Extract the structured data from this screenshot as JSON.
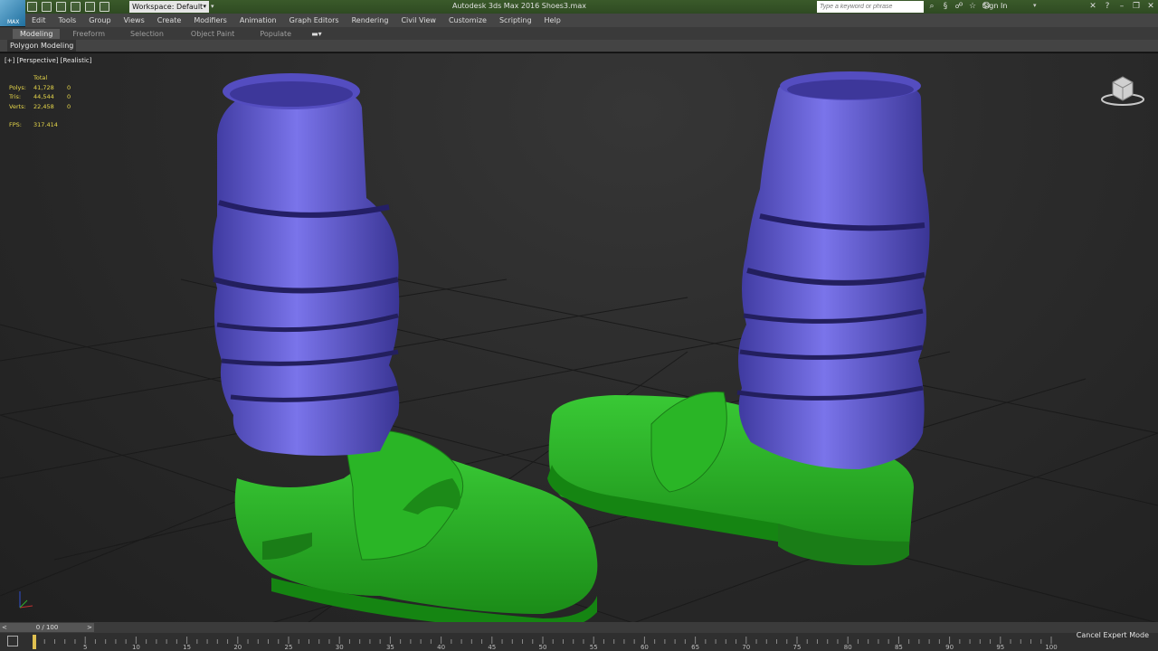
{
  "titlebar": {
    "app_title": "Autodesk 3ds Max 2016      Shoes3.max",
    "workspace": "Workspace: Default",
    "search_placeholder": "Type a keyword or phrase",
    "sign_in": "Sign In",
    "logo": "MAX"
  },
  "menu": [
    "Edit",
    "Tools",
    "Group",
    "Views",
    "Create",
    "Modifiers",
    "Animation",
    "Graph Editors",
    "Rendering",
    "Civil View",
    "Customize",
    "Scripting",
    "Help"
  ],
  "ribbon": {
    "tabs": [
      "Modeling",
      "Freeform",
      "Selection",
      "Object Paint",
      "Populate"
    ],
    "active_tab": "Modeling",
    "panel_label": "Polygon Modeling"
  },
  "viewport": {
    "label": "[+] [Perspective] [Realistic]",
    "stats": {
      "header": "Total",
      "rows": [
        {
          "key": "Polys:",
          "total": "41,728",
          "sel": "0"
        },
        {
          "key": "Tris:",
          "total": "44,544",
          "sel": "0"
        },
        {
          "key": "Verts:",
          "total": "22,458",
          "sel": "0"
        }
      ],
      "fps_label": "FPS:",
      "fps_value": "317.414"
    },
    "colors": {
      "sock": "#6a63d8",
      "shoe": "#2fb22a",
      "grid": "#1a1a1a"
    }
  },
  "timeline": {
    "slider_text": "0 / 100",
    "ticks": [
      "0",
      "5",
      "10",
      "15",
      "20",
      "25",
      "30",
      "35",
      "40",
      "45",
      "50",
      "55",
      "60",
      "65",
      "70",
      "75",
      "80",
      "85",
      "90",
      "95",
      "100"
    ],
    "cancel_expert": "Cancel Expert Mode"
  }
}
